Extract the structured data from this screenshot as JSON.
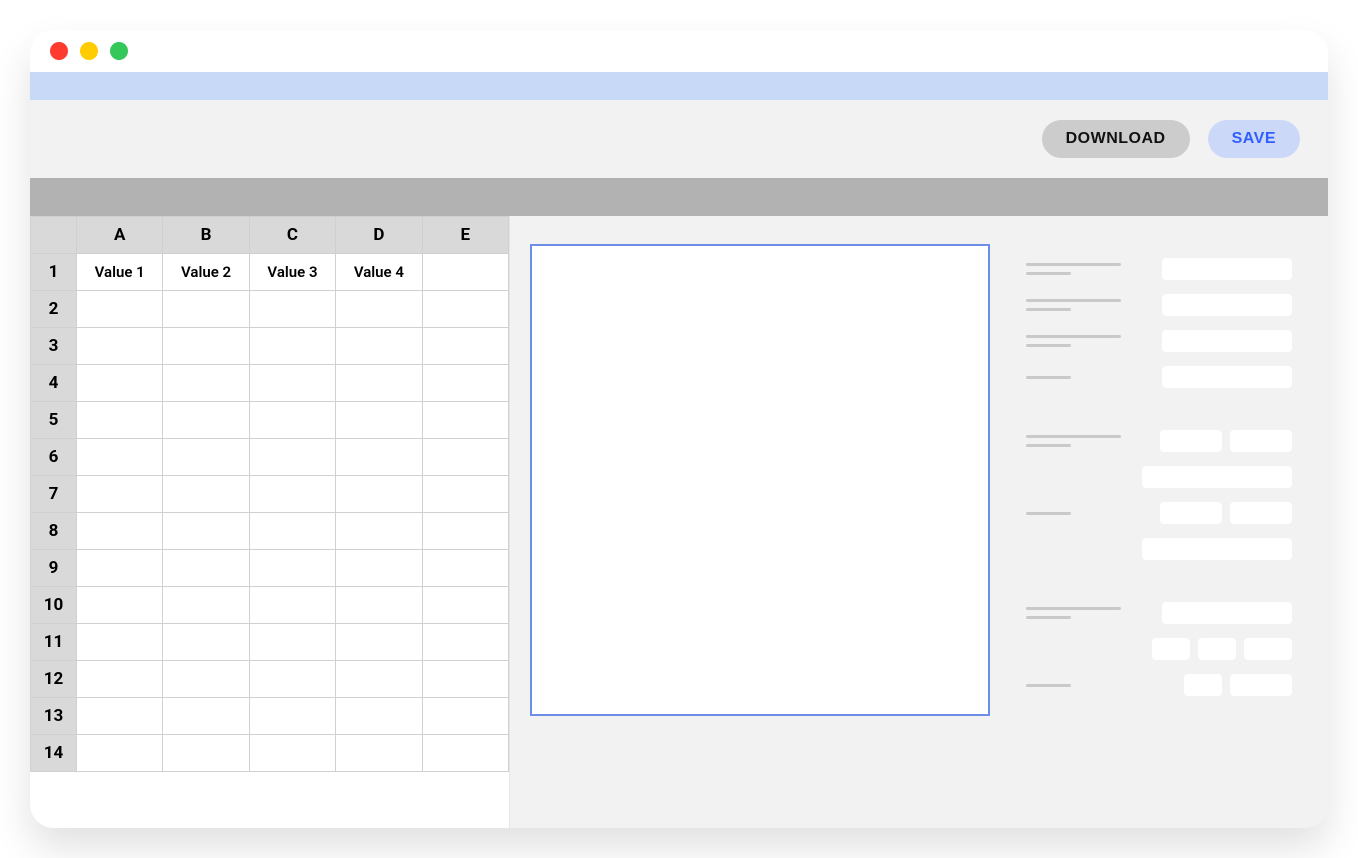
{
  "traffic_lights": [
    "red",
    "yellow",
    "green"
  ],
  "toolbar": {
    "download_label": "DOWNLOAD",
    "save_label": "SAVE"
  },
  "sheet": {
    "columns": [
      "A",
      "B",
      "C",
      "D",
      "E"
    ],
    "row_count": 14,
    "rows": [
      [
        "Value 1",
        "Value 2",
        "Value 3",
        "Value 4",
        ""
      ],
      [
        "",
        "",
        "",
        "",
        ""
      ],
      [
        "",
        "",
        "",
        "",
        ""
      ],
      [
        "",
        "",
        "",
        "",
        ""
      ],
      [
        "",
        "",
        "",
        "",
        ""
      ],
      [
        "",
        "",
        "",
        "",
        ""
      ],
      [
        "",
        "",
        "",
        "",
        ""
      ],
      [
        "",
        "",
        "",
        "",
        ""
      ],
      [
        "",
        "",
        "",
        "",
        ""
      ],
      [
        "",
        "",
        "",
        "",
        ""
      ],
      [
        "",
        "",
        "",
        "",
        ""
      ],
      [
        "",
        "",
        "",
        "",
        ""
      ],
      [
        "",
        "",
        "",
        "",
        ""
      ],
      [
        "",
        "",
        "",
        "",
        ""
      ]
    ]
  },
  "colors": {
    "accent_bar": "#c8d8f7",
    "save_fg": "#2f5fff",
    "page_border": "#6b8fe6"
  }
}
